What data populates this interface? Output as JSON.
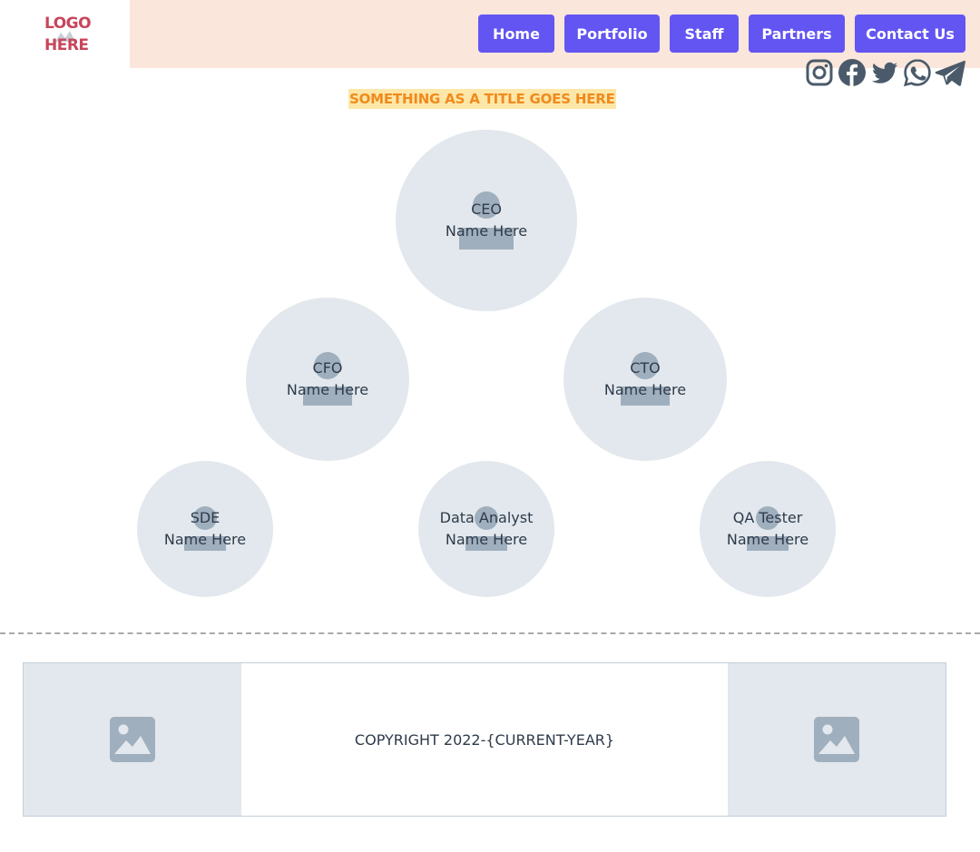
{
  "logo": {
    "text": "LOGO HERE"
  },
  "nav": {
    "items": [
      {
        "label": "Home"
      },
      {
        "label": "Portfolio"
      },
      {
        "label": "Staff"
      },
      {
        "label": "Partners"
      },
      {
        "label": "Contact Us"
      }
    ],
    "color": "#6355f2"
  },
  "social": [
    "instagram-icon",
    "facebook-icon",
    "twitter-icon",
    "whatsapp-icon",
    "telegram-icon"
  ],
  "title": "SOMETHING AS A TITLE GOES HERE",
  "org": {
    "ceo": {
      "role": "CEO",
      "name": "Name Here"
    },
    "cfo": {
      "role": "CFO",
      "name": "Name Here"
    },
    "cto": {
      "role": "CTO",
      "name": "Name Here"
    },
    "sde": {
      "role": "SDE",
      "name": "Name Here"
    },
    "data_analyst": {
      "role": "Data Analyst",
      "name": "Name Here"
    },
    "qa_tester": {
      "role": "QA Tester",
      "name": "Name Here"
    }
  },
  "footer": {
    "copyright": "COPYRIGHT 2022-{CURRENT-YEAR}"
  },
  "colors": {
    "header_bg": "#fae6da",
    "accent": "#6355f2",
    "logo": "#c8455b",
    "title_text": "#f08a1c",
    "title_bg": "#fde7a8",
    "node_bg": "#e2e8ed"
  }
}
